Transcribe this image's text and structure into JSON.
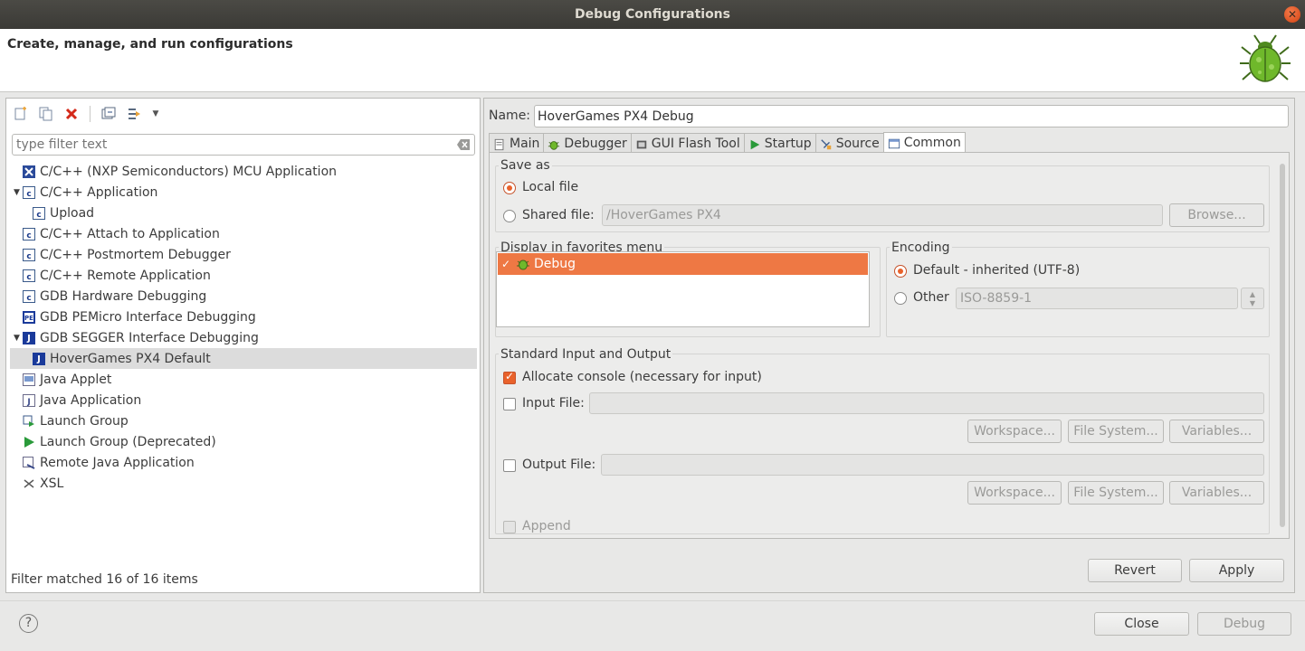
{
  "window": {
    "title": "Debug Configurations",
    "header": "Create, manage, and run configurations"
  },
  "filter": {
    "placeholder": "type filter text",
    "status": "Filter matched 16 of 16 items"
  },
  "tree": [
    {
      "label": "C/C++ (NXP Semiconductors) MCU Application",
      "icon": "nxp-mcu-icon",
      "level": 0,
      "expanded": null
    },
    {
      "label": "C/C++ Application",
      "icon": "c-app-icon",
      "level": 0,
      "expanded": true
    },
    {
      "label": "Upload",
      "icon": "c-config-icon",
      "level": 1,
      "expanded": null
    },
    {
      "label": "C/C++ Attach to Application",
      "icon": "c-app-icon",
      "level": 0,
      "expanded": null
    },
    {
      "label": "C/C++ Postmortem Debugger",
      "icon": "c-app-icon",
      "level": 0,
      "expanded": null
    },
    {
      "label": "C/C++ Remote Application",
      "icon": "c-app-icon",
      "level": 0,
      "expanded": null
    },
    {
      "label": "GDB Hardware Debugging",
      "icon": "c-app-icon",
      "level": 0,
      "expanded": null
    },
    {
      "label": "GDB PEMicro Interface Debugging",
      "icon": "pemicro-icon",
      "level": 0,
      "expanded": null
    },
    {
      "label": "GDB SEGGER Interface Debugging",
      "icon": "segger-jlink-icon",
      "level": 0,
      "expanded": true
    },
    {
      "label": "HoverGames PX4 Default",
      "icon": "segger-jlink-icon",
      "level": 1,
      "expanded": null,
      "selected": true
    },
    {
      "label": "Java Applet",
      "icon": "java-applet-icon",
      "level": 0,
      "expanded": null
    },
    {
      "label": "Java Application",
      "icon": "java-app-icon",
      "level": 0,
      "expanded": null
    },
    {
      "label": "Launch Group",
      "icon": "launch-group-icon",
      "level": 0,
      "expanded": null
    },
    {
      "label": "Launch Group (Deprecated)",
      "icon": "launch-group-deprecated-icon",
      "level": 0,
      "expanded": null
    },
    {
      "label": "Remote Java Application",
      "icon": "remote-java-icon",
      "level": 0,
      "expanded": null
    },
    {
      "label": "XSL",
      "icon": "xsl-icon",
      "level": 0,
      "expanded": null
    }
  ],
  "config": {
    "name_label": "Name:",
    "name_value": "HoverGames PX4 Debug"
  },
  "tabs": [
    {
      "label": "Main",
      "icon": "main-tab-icon"
    },
    {
      "label": "Debugger",
      "icon": "debugger-tab-icon"
    },
    {
      "label": "GUI Flash Tool",
      "icon": "flash-tool-icon"
    },
    {
      "label": "Startup",
      "icon": "startup-tab-icon"
    },
    {
      "label": "Source",
      "icon": "source-tab-icon"
    },
    {
      "label": "Common",
      "icon": "common-tab-icon",
      "active": true
    }
  ],
  "common": {
    "save_as": {
      "title": "Save as",
      "local_file_label": "Local file",
      "local_file_selected": true,
      "shared_file_label": "Shared file:",
      "shared_file_value": "/HoverGames PX4",
      "browse_label": "Browse..."
    },
    "favorites": {
      "title": "Display in favorites menu",
      "items": [
        {
          "label": "Debug",
          "checked": true
        }
      ]
    },
    "encoding": {
      "title": "Encoding",
      "default_label": "Default - inherited (UTF-8)",
      "default_selected": true,
      "other_label": "Other",
      "other_value": "ISO-8859-1"
    },
    "io": {
      "title": "Standard Input and Output",
      "allocate_console_label": "Allocate console (necessary for input)",
      "allocate_console_checked": true,
      "input_file_label": "Input File:",
      "output_file_label": "Output File:",
      "workspace_label": "Workspace...",
      "file_system_label": "File System...",
      "variables_label": "Variables...",
      "append_label": "Append"
    }
  },
  "buttons": {
    "revert": "Revert",
    "apply": "Apply",
    "close": "Close",
    "debug": "Debug"
  },
  "colors": {
    "accent": "#e9622b",
    "selection": "#ee7844",
    "titlebar": "#3b3a36"
  }
}
